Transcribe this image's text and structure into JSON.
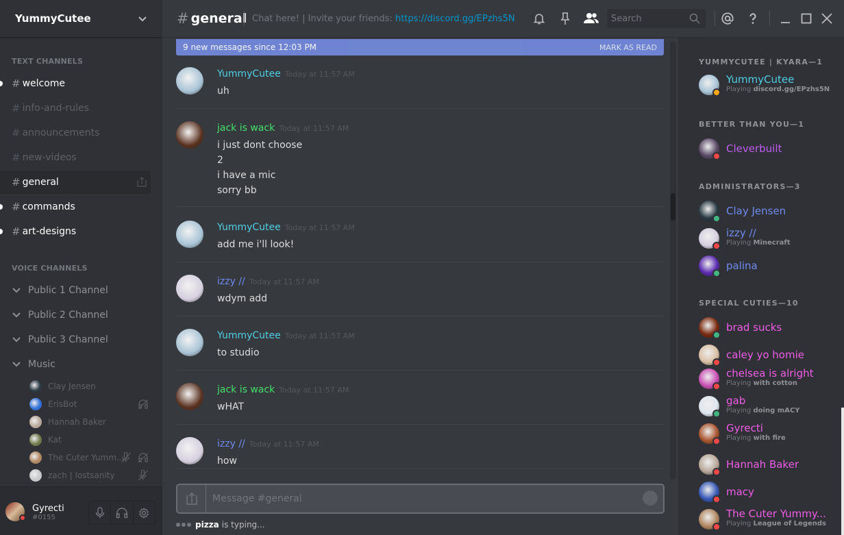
{
  "guild": {
    "name": "YummyCutee"
  },
  "sidebar": {
    "text_category": "TEXT CHANNELS",
    "voice_category": "VOICE CHANNELS",
    "text_channels": [
      {
        "name": "welcome",
        "state": "unread"
      },
      {
        "name": "info-and-rules",
        "state": "muted"
      },
      {
        "name": "announcements",
        "state": "muted"
      },
      {
        "name": "new-videos",
        "state": "muted"
      },
      {
        "name": "general",
        "state": "active"
      },
      {
        "name": "commands",
        "state": "unread"
      },
      {
        "name": "art-designs",
        "state": "unread"
      }
    ],
    "voice_channels": [
      {
        "name": "Public 1 Channel"
      },
      {
        "name": "Public 2 Channel"
      },
      {
        "name": "Public 3 Channel"
      },
      {
        "name": "Music"
      }
    ],
    "voice_users": [
      {
        "name": "Clay Jensen",
        "muted": false,
        "deafened": false,
        "color": "#2a3a44"
      },
      {
        "name": "ErisBot",
        "muted": false,
        "deafened": true,
        "color": "#2f6fd8"
      },
      {
        "name": "Hannah Baker",
        "muted": false,
        "deafened": false,
        "color": "#b8a89a"
      },
      {
        "name": "Kat",
        "muted": false,
        "deafened": false,
        "color": "#6f7a4c"
      },
      {
        "name": "The Cuter Yumm...",
        "muted": true,
        "deafened": true,
        "color": "#b08760"
      },
      {
        "name": "zach | lostsanity",
        "muted": true,
        "deafened": false,
        "color": "#c7c9cc"
      }
    ]
  },
  "user": {
    "name": "Gyrecti",
    "tag": "#0155",
    "status": "dnd"
  },
  "header": {
    "channel": "general",
    "topic_prefix": "Chat here! | Invite your friends: ",
    "topic_link": "https://discord.gg/EPzhs5N",
    "search_placeholder": "Search"
  },
  "chat": {
    "new_messages_banner": "9 new messages since 12:03 PM",
    "mark_as_read": "MARK AS READ",
    "messages": [
      {
        "author": "YummyCutee",
        "color": "#4fcfe6",
        "time": "Today at 11:57 AM",
        "lines": [
          "uh"
        ],
        "avatar": "#a9c4d6"
      },
      {
        "author": "jack is wack",
        "color": "#43e06a",
        "time": "Today at 11:57 AM",
        "lines": [
          "i just dont choose",
          "2",
          "i have a mic",
          "sorry bb"
        ],
        "avatar": "#5b3220"
      },
      {
        "author": "YummyCutee",
        "color": "#4fcfe6",
        "time": "Today at 11:57 AM",
        "lines": [
          "add me i'll look!"
        ],
        "avatar": "#a9c4d6"
      },
      {
        "author": "izzy //",
        "color": "#6f8bf0",
        "time": "Today at 11:57 AM",
        "lines": [
          "wdym add"
        ],
        "avatar": "#d6d0e0"
      },
      {
        "author": "YummyCutee",
        "color": "#4fcfe6",
        "time": "Today at 11:57 AM",
        "lines": [
          "to studio"
        ],
        "avatar": "#a9c4d6"
      },
      {
        "author": "jack is wack",
        "color": "#43e06a",
        "time": "Today at 11:57 AM",
        "lines": [
          "wHAT"
        ],
        "avatar": "#5b3220"
      },
      {
        "author": "izzy //",
        "color": "#6f8bf0",
        "time": "Today at 11:57 AM",
        "lines": [
          "how"
        ],
        "avatar": "#d6d0e0"
      }
    ],
    "composer_placeholder": "Message #general",
    "typing_user": "pizza",
    "typing_suffix": "is typing..."
  },
  "members": {
    "groups": [
      {
        "title": "YUMMYCUTEE | KYARA—1",
        "members": [
          {
            "name": "YummyCutee",
            "color": "#4fcfe6",
            "status": "idle",
            "game": "discord.gg/EPzhs5N",
            "avatar": "#a9c4d6"
          }
        ]
      },
      {
        "title": "BETTER THAN YOU—1",
        "members": [
          {
            "name": "Cleverbuilt",
            "color": "#c05cf0",
            "status": "dnd",
            "game": null,
            "avatar": "#5a4a66"
          }
        ]
      },
      {
        "title": "ADMINISTRATORS—3",
        "members": [
          {
            "name": "Clay Jensen",
            "color": "#6f8bf0",
            "status": "online",
            "game": null,
            "avatar": "#2a3a44"
          },
          {
            "name": "izzy //",
            "color": "#6f8bf0",
            "status": "dnd",
            "game": "Minecraft",
            "avatar": "#d6d0e0"
          },
          {
            "name": "palina",
            "color": "#6f8bf0",
            "status": "online",
            "game": null,
            "avatar": "#5b2bb0"
          }
        ]
      },
      {
        "title": "SPECIAL CUTIES—10",
        "members": [
          {
            "name": "brad sucks",
            "color": "#f05ce6",
            "status": "online",
            "game": null,
            "avatar": "#7a2a10"
          },
          {
            "name": "caley yo homie",
            "color": "#f05ce6",
            "status": "dnd",
            "game": null,
            "avatar": "#d9c1a5"
          },
          {
            "name": "chelsea is alright",
            "color": "#f05ce6",
            "status": "dnd",
            "game": "with cotton",
            "avatar": "#c94fb3"
          },
          {
            "name": "gab",
            "color": "#f05ce6",
            "status": "online",
            "game": "doing mACY",
            "avatar": "#dde6ee"
          },
          {
            "name": "Gyrecti",
            "color": "#f05ce6",
            "status": "dnd",
            "game": "with fire",
            "avatar": "#a8552e"
          },
          {
            "name": "Hannah Baker",
            "color": "#f05ce6",
            "status": "dnd",
            "game": null,
            "avatar": "#b8a89a"
          },
          {
            "name": "macy",
            "color": "#f05ce6",
            "status": "dnd",
            "game": null,
            "avatar": "#3558b5"
          },
          {
            "name": "The Cuter Yummy...",
            "color": "#f05ce6",
            "status": "dnd",
            "game": "League of Legends",
            "avatar": "#b08760"
          }
        ]
      }
    ],
    "playing_label": "Playing"
  },
  "status_colors": {
    "online": "#43b581",
    "idle": "#faa61a",
    "dnd": "#f04747"
  }
}
